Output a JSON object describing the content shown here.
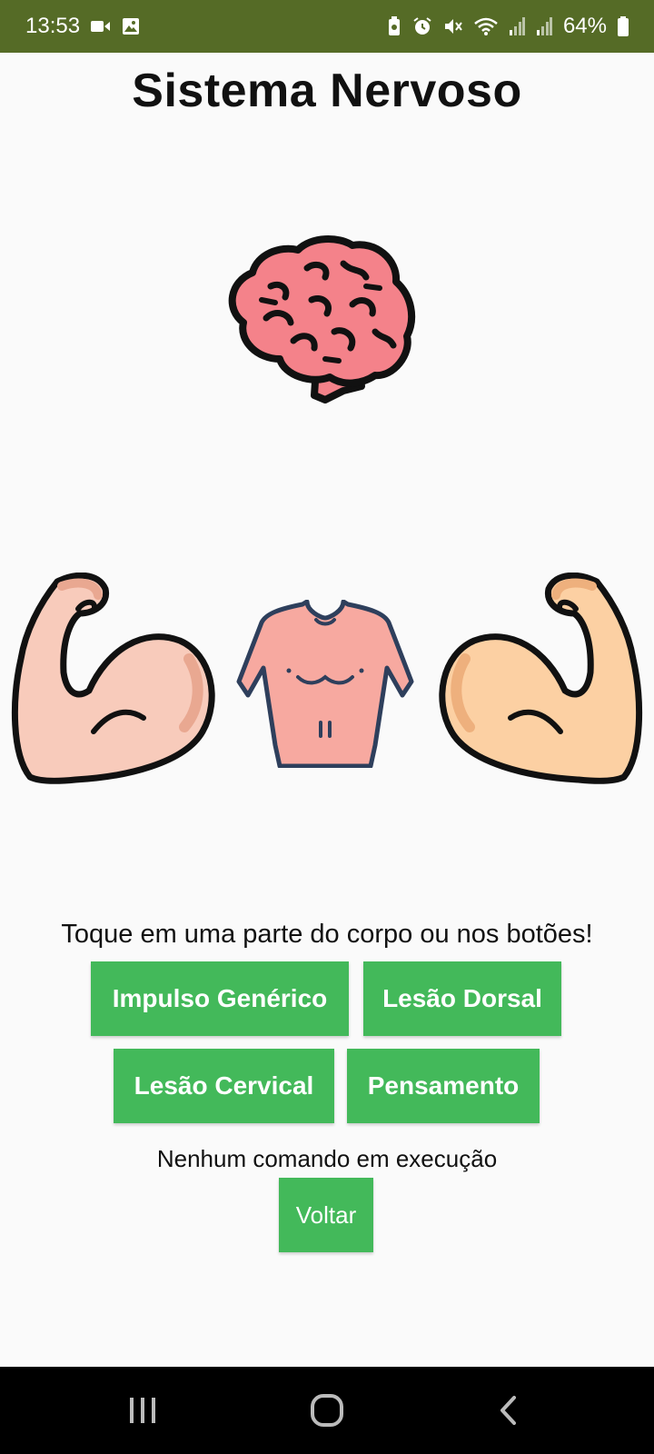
{
  "status_bar": {
    "time": "13:53",
    "battery": "64%",
    "background": "#556b26",
    "icons_left": [
      "video-icon",
      "image-icon"
    ],
    "icons_right": [
      "battery-saver-icon",
      "alarm-icon",
      "mute-icon",
      "wifi-icon",
      "signal-icon",
      "signal-icon",
      "battery-icon"
    ]
  },
  "page": {
    "title": "Sistema Nervoso",
    "illustrations": [
      "brain-icon",
      "left-arm-icon",
      "torso-icon",
      "right-arm-icon"
    ],
    "instruction": "Toque em uma parte do corpo ou nos botões!",
    "buttons": {
      "impulso": "Impulso Genérico",
      "dorsal": "Lesão Dorsal",
      "cervical": "Lesão Cervical",
      "pensamento": "Pensamento"
    },
    "status_text": "Nenhum comando em execução",
    "back_button": "Voltar",
    "button_color": "#43b95a"
  },
  "nav_bar": {
    "icons": [
      "recents-icon",
      "home-icon",
      "back-icon"
    ]
  }
}
